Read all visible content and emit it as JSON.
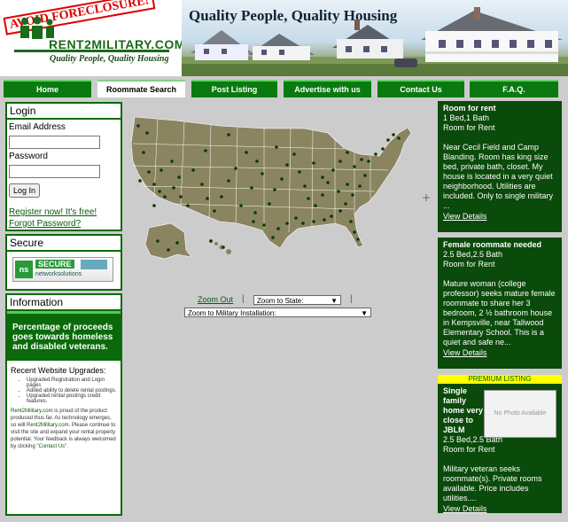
{
  "header": {
    "stamp": "AVOID FORECLOSURE!",
    "logo": "RENT2MILITARY.COM",
    "tagline": "Quality People, Quality Housing",
    "banner_title": "Quality People, Quality Housing"
  },
  "nav": [
    "Home",
    "Roommate Search",
    "Post Listing",
    "Advertise with us",
    "Contact Us",
    "F.A.Q."
  ],
  "login": {
    "title": "Login",
    "email_label": "Email Address",
    "password_label": "Password",
    "button": "Log In",
    "register": "Register now! It's free!",
    "forgot": "Forgot Password?"
  },
  "secure": {
    "title": "Secure",
    "badge_main": "SECURE",
    "badge_sub": "networksolutions"
  },
  "information": {
    "title": "Information",
    "highlight": "Percentage of proceeds goes towards homeless and disabled veterans.",
    "upgrades_title": "Recent Website Upgrades:",
    "upgrades": [
      "Upgraded Registration and Login pages",
      "Added ability to delete rental postings.",
      "Upgraded rental postings credit features."
    ],
    "footer_link1": "Rent2Military.com",
    "footer_text1": " is proud of the product produced thus far. As technology emerges, so will ",
    "footer_link2": "Rent2Military.com",
    "footer_text2": ". Please continue to visit the site and expand your rental property potential. Your feedback is always welcomed by clicking \"",
    "footer_link3": "Contact Us",
    "footer_text3": "\"."
  },
  "map_controls": {
    "zoom_out": "Zoom Out",
    "zoom_state": "Zoom to State:",
    "zoom_installation": "Zoom to Military Installation:",
    "separator": "|"
  },
  "listings": [
    {
      "title": "Room for rent",
      "beds": "1 Bed,1 Bath",
      "type": "Room for Rent",
      "desc": "Near Cecil Field and Camp Blanding. Room has king size bed, private bath, closet. My house is located in a very quiet neighborhood. Utilities are included. Only to single military ...",
      "link": "View Details"
    },
    {
      "title": "Female roommate needed",
      "beds": "2.5 Bed,2.5 Bath",
      "type": "Room for Rent",
      "desc": "Mature woman (college professor) seeks mature female roommate to share her 3 bedroom, 2 ½ bathroom house in Kempsville, near Tallwood Elementary School. This is a quiet and safe ne...",
      "link": "View Details"
    },
    {
      "premium": "PREMIUM LISTING",
      "title": "Single family home very close to JBLM",
      "beds": "2.5 Bed,2.5 Bath",
      "type": "Room for Rent",
      "photo": "No Photo Available",
      "desc": "Military veteran seeks roommate(s). Private rooms available. Price includes utilities....",
      "link": "View Details"
    }
  ],
  "colors": {
    "brand_green": "#0a6a0a",
    "dark_green": "#0a4a0a",
    "map_land": "#8a8560",
    "marker": "#0a3a0a",
    "premium": "#ffff00"
  }
}
